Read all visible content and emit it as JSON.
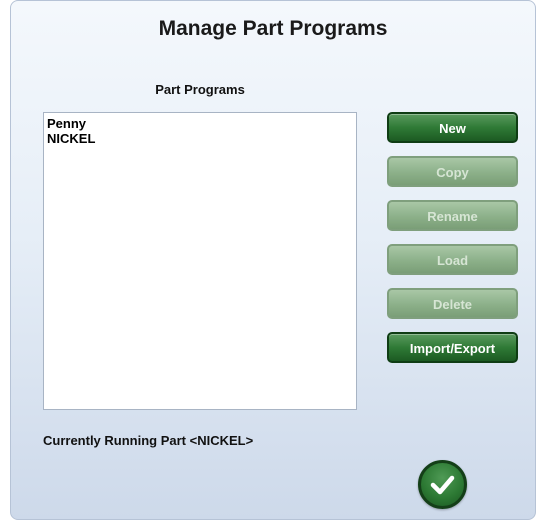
{
  "dialog": {
    "title": "Manage Part Programs"
  },
  "list": {
    "label": "Part Programs",
    "items": [
      "Penny",
      "NICKEL"
    ]
  },
  "buttons": {
    "new": "New",
    "copy": "Copy",
    "rename": "Rename",
    "load": "Load",
    "delete": "Delete",
    "import_export": "Import/Export"
  },
  "status": {
    "text": "Currently Running Part <NICKEL>"
  },
  "ok_button": {
    "icon": "checkmark-icon"
  },
  "colors": {
    "enabled_button": "#2f7a36",
    "disabled_button": "#8cb089",
    "dialog_bg": "#e6eef7"
  }
}
